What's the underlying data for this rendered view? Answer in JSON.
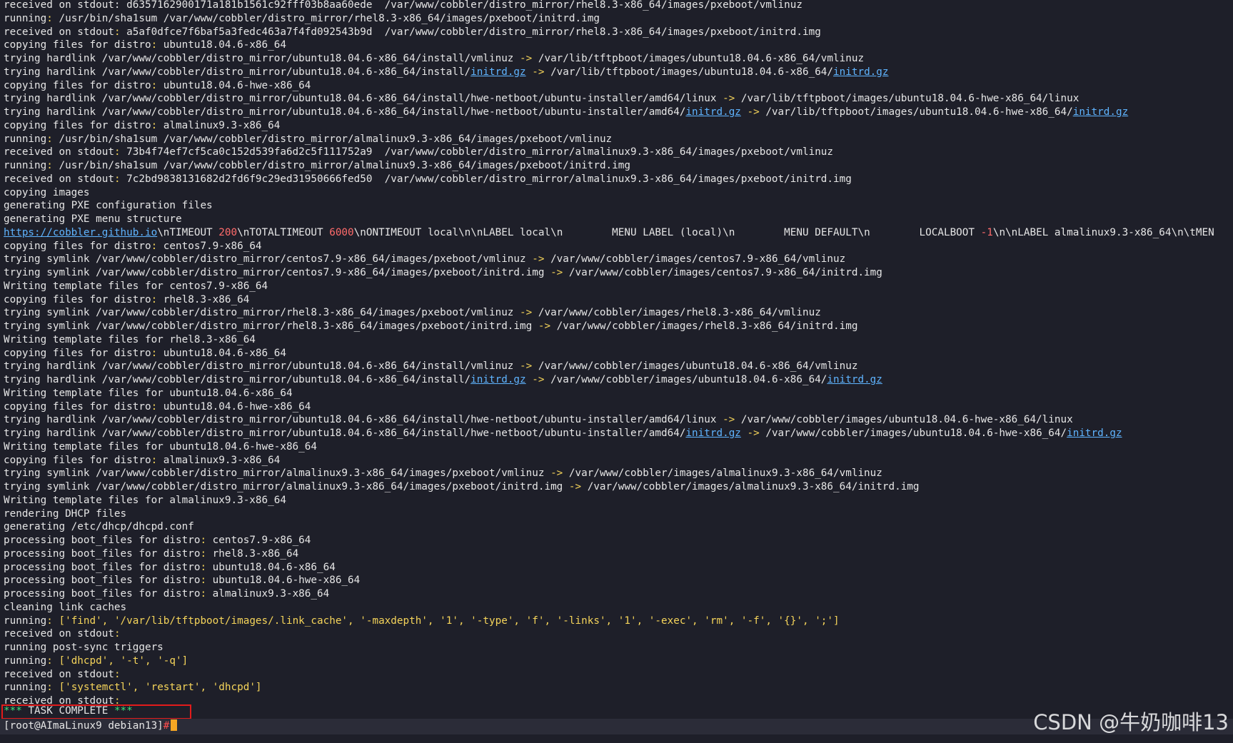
{
  "terminal": {
    "lines": [
      [
        {
          "t": "received on stdout: d6357162900171a181b1561c92fff03b8aa60ede  /var/www/cobbler/distro_mirror/rhel8.3-x86_64/images/pxeboot/vmlinuz"
        }
      ],
      [
        {
          "t": "running"
        },
        {
          "t": ":",
          "c": "sym"
        },
        {
          "t": " /usr/bin/sha1sum /var/www/cobbler/distro_mirror/rhel8.3-x86_64/images/pxeboot/initrd.img"
        }
      ],
      [
        {
          "t": "received on stdout"
        },
        {
          "t": ":",
          "c": "sym"
        },
        {
          "t": " a5af0dfce7f6baf5a3fedc463a7f4fd092543b9d  /var/www/cobbler/distro_mirror/rhel8.3-x86_64/images/pxeboot/initrd.img"
        }
      ],
      [
        {
          "t": "copying files for distro"
        },
        {
          "t": ":",
          "c": "sym"
        },
        {
          "t": " ubuntu18.04.6-x86_64"
        }
      ],
      [
        {
          "t": "trying hardlink /var/www/cobbler/distro_mirror/ubuntu18.04.6-x86_64/install/vmlinuz "
        },
        {
          "t": "->",
          "c": "sym"
        },
        {
          "t": " /var/lib/tftpboot/images/ubuntu18.04.6-x86_64/vmlinuz"
        }
      ],
      [
        {
          "t": "trying hardlink /var/www/cobbler/distro_mirror/ubuntu18.04.6-x86_64/install/"
        },
        {
          "t": "initrd.gz",
          "c": "lnk"
        },
        {
          "t": " "
        },
        {
          "t": "->",
          "c": "sym"
        },
        {
          "t": " /var/lib/tftpboot/images/ubuntu18.04.6-x86_64/"
        },
        {
          "t": "initrd.gz",
          "c": "lnk"
        }
      ],
      [
        {
          "t": "copying files for distro"
        },
        {
          "t": ":",
          "c": "sym"
        },
        {
          "t": " ubuntu18.04.6-hwe-x86_64"
        }
      ],
      [
        {
          "t": "trying hardlink /var/www/cobbler/distro_mirror/ubuntu18.04.6-x86_64/install/hwe-netboot/ubuntu-installer/amd64/linux "
        },
        {
          "t": "->",
          "c": "sym"
        },
        {
          "t": " /var/lib/tftpboot/images/ubuntu18.04.6-hwe-x86_64/linux"
        }
      ],
      [
        {
          "t": "trying hardlink /var/www/cobbler/distro_mirror/ubuntu18.04.6-x86_64/install/hwe-netboot/ubuntu-installer/amd64/"
        },
        {
          "t": "initrd.gz",
          "c": "lnk"
        },
        {
          "t": " "
        },
        {
          "t": "->",
          "c": "sym"
        },
        {
          "t": " /var/lib/tftpboot/images/ubuntu18.04.6-hwe-x86_64/"
        },
        {
          "t": "initrd.gz",
          "c": "lnk"
        }
      ],
      [
        {
          "t": "copying files for distro"
        },
        {
          "t": ":",
          "c": "sym"
        },
        {
          "t": " almalinux9.3-x86_64"
        }
      ],
      [
        {
          "t": "running"
        },
        {
          "t": ":",
          "c": "sym"
        },
        {
          "t": " /usr/bin/sha1sum /var/www/cobbler/distro_mirror/almalinux9.3-x86_64/images/pxeboot/vmlinuz"
        }
      ],
      [
        {
          "t": "received on stdout"
        },
        {
          "t": ":",
          "c": "sym"
        },
        {
          "t": " 73b4f74ef7cf5ca0c152d539fa6d2c5f111752a9  /var/www/cobbler/distro_mirror/almalinux9.3-x86_64/images/pxeboot/vmlinuz"
        }
      ],
      [
        {
          "t": "running"
        },
        {
          "t": ":",
          "c": "sym"
        },
        {
          "t": " /usr/bin/sha1sum /var/www/cobbler/distro_mirror/almalinux9.3-x86_64/images/pxeboot/initrd.img"
        }
      ],
      [
        {
          "t": "received on stdout"
        },
        {
          "t": ":",
          "c": "sym"
        },
        {
          "t": " 7c2bd9838131682d2fd6f9c29ed31950666fed50  /var/www/cobbler/distro_mirror/almalinux9.3-x86_64/images/pxeboot/initrd.img"
        }
      ],
      [
        {
          "t": "copying images"
        }
      ],
      [
        {
          "t": "generating PXE configuration files"
        }
      ],
      [
        {
          "t": "generating PXE menu structure"
        }
      ],
      [
        {
          "t": "https://cobbler.github.io",
          "c": "lnk"
        },
        {
          "t": "\\nTIMEOUT "
        },
        {
          "t": "200",
          "c": "num"
        },
        {
          "t": "\\nTOTALTIMEOUT "
        },
        {
          "t": "6000",
          "c": "num"
        },
        {
          "t": "\\nONTIMEOUT local\\n\\nLABEL local\\n        MENU LABEL (local)\\n        MENU DEFAULT\\n        LOCALBOOT "
        },
        {
          "t": "-1",
          "c": "num"
        },
        {
          "t": "\\n\\nLABEL almalinux9.3-x86_64\\n\\tMEN"
        }
      ],
      [
        {
          "t": "copying files for distro"
        },
        {
          "t": ":",
          "c": "sym"
        },
        {
          "t": " centos7.9-x86_64"
        }
      ],
      [
        {
          "t": "trying symlink /var/www/cobbler/distro_mirror/centos7.9-x86_64/images/pxeboot/vmlinuz "
        },
        {
          "t": "->",
          "c": "sym"
        },
        {
          "t": " /var/www/cobbler/images/centos7.9-x86_64/vmlinuz"
        }
      ],
      [
        {
          "t": "trying symlink /var/www/cobbler/distro_mirror/centos7.9-x86_64/images/pxeboot/initrd.img "
        },
        {
          "t": "->",
          "c": "sym"
        },
        {
          "t": " /var/www/cobbler/images/centos7.9-x86_64/initrd.img"
        }
      ],
      [
        {
          "t": "Writing template files for centos7.9-x86_64"
        }
      ],
      [
        {
          "t": "copying files for distro"
        },
        {
          "t": ":",
          "c": "sym"
        },
        {
          "t": " rhel8.3-x86_64"
        }
      ],
      [
        {
          "t": "trying symlink /var/www/cobbler/distro_mirror/rhel8.3-x86_64/images/pxeboot/vmlinuz "
        },
        {
          "t": "->",
          "c": "sym"
        },
        {
          "t": " /var/www/cobbler/images/rhel8.3-x86_64/vmlinuz"
        }
      ],
      [
        {
          "t": "trying symlink /var/www/cobbler/distro_mirror/rhel8.3-x86_64/images/pxeboot/initrd.img "
        },
        {
          "t": "->",
          "c": "sym"
        },
        {
          "t": " /var/www/cobbler/images/rhel8.3-x86_64/initrd.img"
        }
      ],
      [
        {
          "t": "Writing template files for rhel8.3-x86_64"
        }
      ],
      [
        {
          "t": "copying files for distro"
        },
        {
          "t": ":",
          "c": "sym"
        },
        {
          "t": " ubuntu18.04.6-x86_64"
        }
      ],
      [
        {
          "t": "trying hardlink /var/www/cobbler/distro_mirror/ubuntu18.04.6-x86_64/install/vmlinuz "
        },
        {
          "t": "->",
          "c": "sym"
        },
        {
          "t": " /var/www/cobbler/images/ubuntu18.04.6-x86_64/vmlinuz"
        }
      ],
      [
        {
          "t": "trying hardlink /var/www/cobbler/distro_mirror/ubuntu18.04.6-x86_64/install/"
        },
        {
          "t": "initrd.gz",
          "c": "lnk"
        },
        {
          "t": " "
        },
        {
          "t": "->",
          "c": "sym"
        },
        {
          "t": " /var/www/cobbler/images/ubuntu18.04.6-x86_64/"
        },
        {
          "t": "initrd.gz",
          "c": "lnk"
        }
      ],
      [
        {
          "t": "Writing template files for ubuntu18.04.6-x86_64"
        }
      ],
      [
        {
          "t": "copying files for distro"
        },
        {
          "t": ":",
          "c": "sym"
        },
        {
          "t": " ubuntu18.04.6-hwe-x86_64"
        }
      ],
      [
        {
          "t": "trying hardlink /var/www/cobbler/distro_mirror/ubuntu18.04.6-x86_64/install/hwe-netboot/ubuntu-installer/amd64/linux "
        },
        {
          "t": "->",
          "c": "sym"
        },
        {
          "t": " /var/www/cobbler/images/ubuntu18.04.6-hwe-x86_64/linux"
        }
      ],
      [
        {
          "t": "trying hardlink /var/www/cobbler/distro_mirror/ubuntu18.04.6-x86_64/install/hwe-netboot/ubuntu-installer/amd64/"
        },
        {
          "t": "initrd.gz",
          "c": "lnk"
        },
        {
          "t": " "
        },
        {
          "t": "->",
          "c": "sym"
        },
        {
          "t": " /var/www/cobbler/images/ubuntu18.04.6-hwe-x86_64/"
        },
        {
          "t": "initrd.gz",
          "c": "lnk"
        }
      ],
      [
        {
          "t": "Writing template files for ubuntu18.04.6-hwe-x86_64"
        }
      ],
      [
        {
          "t": "copying files for distro"
        },
        {
          "t": ":",
          "c": "sym"
        },
        {
          "t": " almalinux9.3-x86_64"
        }
      ],
      [
        {
          "t": "trying symlink /var/www/cobbler/distro_mirror/almalinux9.3-x86_64/images/pxeboot/vmlinuz "
        },
        {
          "t": "->",
          "c": "sym"
        },
        {
          "t": " /var/www/cobbler/images/almalinux9.3-x86_64/vmlinuz"
        }
      ],
      [
        {
          "t": "trying symlink /var/www/cobbler/distro_mirror/almalinux9.3-x86_64/images/pxeboot/initrd.img "
        },
        {
          "t": "->",
          "c": "sym"
        },
        {
          "t": " /var/www/cobbler/images/almalinux9.3-x86_64/initrd.img"
        }
      ],
      [
        {
          "t": "Writing template files for almalinux9.3-x86_64"
        }
      ],
      [
        {
          "t": "rendering DHCP files"
        }
      ],
      [
        {
          "t": "generating /etc/dhcp/dhcpd.conf"
        }
      ],
      [
        {
          "t": "processing boot_files for distro"
        },
        {
          "t": ":",
          "c": "sym"
        },
        {
          "t": " centos7.9-x86_64"
        }
      ],
      [
        {
          "t": "processing boot_files for distro"
        },
        {
          "t": ":",
          "c": "sym"
        },
        {
          "t": " rhel8.3-x86_64"
        }
      ],
      [
        {
          "t": "processing boot_files for distro"
        },
        {
          "t": ":",
          "c": "sym"
        },
        {
          "t": " ubuntu18.04.6-x86_64"
        }
      ],
      [
        {
          "t": "processing boot_files for distro"
        },
        {
          "t": ":",
          "c": "sym"
        },
        {
          "t": " ubuntu18.04.6-hwe-x86_64"
        }
      ],
      [
        {
          "t": "processing boot_files for distro"
        },
        {
          "t": ":",
          "c": "sym"
        },
        {
          "t": " almalinux9.3-x86_64"
        }
      ],
      [
        {
          "t": "cleaning link caches"
        }
      ],
      [
        {
          "t": "running"
        },
        {
          "t": ":",
          "c": "sym"
        },
        {
          "t": " ['find', '/var/lib/tftpboot/images/.link_cache', '-maxdepth', '1', '-type', 'f', '-links', '1', '-exec', 'rm', '-f', '{}', ';']",
          "c": "sym"
        }
      ],
      [
        {
          "t": "received on stdout"
        },
        {
          "t": ":",
          "c": "sym"
        }
      ],
      [
        {
          "t": "running post-sync triggers"
        }
      ],
      [
        {
          "t": "running"
        },
        {
          "t": ":",
          "c": "sym"
        },
        {
          "t": " ['dhcpd', '-t', '-q']",
          "c": "sym"
        }
      ],
      [
        {
          "t": "received on stdout"
        },
        {
          "t": ":",
          "c": "sym"
        }
      ],
      [
        {
          "t": "running"
        },
        {
          "t": ":",
          "c": "sym"
        },
        {
          "t": " ['systemctl', 'restart', 'dhcpd']",
          "c": "sym"
        }
      ],
      [
        {
          "t": "received on stdout"
        },
        {
          "t": ":",
          "c": "sym"
        }
      ]
    ],
    "task_complete": {
      "stars_left": "***",
      "text": " TASK COMPLETE ",
      "stars_right": "***"
    },
    "prompt": {
      "text": "[root@AImaLinux9 debian13]",
      "symbol": "#"
    },
    "watermark": "CSDN @牛奶咖啡13"
  },
  "colors": {
    "background": "#1e1f29",
    "highlight_box": "#e21b1b",
    "link": "#5fb4ff",
    "symbol": "#f5d45a",
    "number": "#ff6b6b",
    "stars": "#3ee07a",
    "cursor": "#f5a623"
  }
}
